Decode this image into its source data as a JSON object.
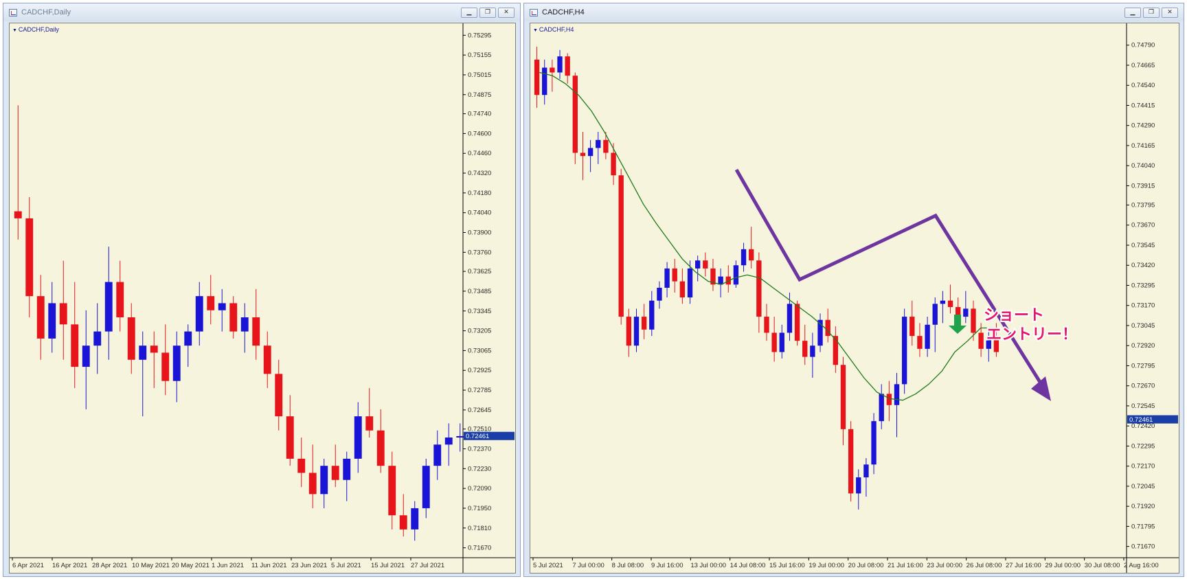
{
  "windows": [
    {
      "title": "CADCHF,Daily",
      "buttons": [
        "minimize",
        "restore",
        "close"
      ]
    },
    {
      "title": "CADCHF,H4",
      "buttons": [
        "minimize",
        "restore",
        "close"
      ]
    }
  ],
  "annotation": {
    "line1": "ショート",
    "line2": "エントリー！"
  },
  "colors": {
    "bull": "#1a14d6",
    "bear": "#e8141b",
    "ma": "#1f7a1a",
    "zigzag": "#6e35a0",
    "arrow": "#1fa34a",
    "background": "#f6f4dc"
  },
  "chart_data": [
    {
      "type": "candlestick",
      "title": "CADCHF,Daily",
      "ylim": [
        0.716,
        0.7535
      ],
      "yticks": [
        "0.75295",
        "0.75155",
        "0.75015",
        "0.74875",
        "0.74740",
        "0.74600",
        "0.74460",
        "0.74320",
        "0.74180",
        "0.74040",
        "0.73900",
        "0.73760",
        "0.73625",
        "0.73485",
        "0.73345",
        "0.73205",
        "0.73065",
        "0.72925",
        "0.72785",
        "0.72645",
        "0.72510",
        "0.72370",
        "0.72230",
        "0.72090",
        "0.71950",
        "0.71810",
        "0.71670"
      ],
      "current_price": "0.72461",
      "xticks": [
        "6 Apr 2021",
        "16 Apr 2021",
        "28 Apr 2021",
        "10 May 2021",
        "20 May 2021",
        "1 Jun 2021",
        "11 Jun 2021",
        "23 Jun 2021",
        "5 Jul 2021",
        "15 Jul 2021",
        "27 Jul 2021"
      ],
      "candles": [
        [
          0.7405,
          0.748,
          0.7385,
          0.74
        ],
        [
          0.74,
          0.7415,
          0.733,
          0.7345
        ],
        [
          0.7345,
          0.736,
          0.73,
          0.7315
        ],
        [
          0.7315,
          0.7355,
          0.7305,
          0.734
        ],
        [
          0.734,
          0.737,
          0.73,
          0.7325
        ],
        [
          0.7325,
          0.7355,
          0.728,
          0.7295
        ],
        [
          0.7295,
          0.7335,
          0.7265,
          0.731
        ],
        [
          0.731,
          0.734,
          0.729,
          0.732
        ],
        [
          0.732,
          0.738,
          0.73,
          0.7355
        ],
        [
          0.7355,
          0.737,
          0.732,
          0.733
        ],
        [
          0.733,
          0.734,
          0.729,
          0.73
        ],
        [
          0.73,
          0.732,
          0.726,
          0.731
        ],
        [
          0.731,
          0.732,
          0.728,
          0.7305
        ],
        [
          0.7305,
          0.7325,
          0.7275,
          0.7285
        ],
        [
          0.7285,
          0.732,
          0.727,
          0.731
        ],
        [
          0.731,
          0.7325,
          0.7295,
          0.732
        ],
        [
          0.732,
          0.7355,
          0.731,
          0.7345
        ],
        [
          0.7345,
          0.736,
          0.7325,
          0.7335
        ],
        [
          0.7335,
          0.735,
          0.732,
          0.734
        ],
        [
          0.734,
          0.7345,
          0.7315,
          0.732
        ],
        [
          0.732,
          0.734,
          0.7305,
          0.733
        ],
        [
          0.733,
          0.735,
          0.73,
          0.731
        ],
        [
          0.731,
          0.732,
          0.728,
          0.729
        ],
        [
          0.729,
          0.73,
          0.725,
          0.726
        ],
        [
          0.726,
          0.7275,
          0.7225,
          0.723
        ],
        [
          0.723,
          0.7245,
          0.721,
          0.722
        ],
        [
          0.722,
          0.724,
          0.7195,
          0.7205
        ],
        [
          0.7205,
          0.723,
          0.7195,
          0.7225
        ],
        [
          0.7225,
          0.724,
          0.721,
          0.7215
        ],
        [
          0.7215,
          0.7235,
          0.72,
          0.723
        ],
        [
          0.723,
          0.727,
          0.722,
          0.726
        ],
        [
          0.726,
          0.728,
          0.7245,
          0.725
        ],
        [
          0.725,
          0.7265,
          0.722,
          0.7225
        ],
        [
          0.7225,
          0.7235,
          0.718,
          0.719
        ],
        [
          0.719,
          0.7205,
          0.7175,
          0.718
        ],
        [
          0.718,
          0.72,
          0.7172,
          0.7195
        ],
        [
          0.7195,
          0.723,
          0.7188,
          0.7225
        ],
        [
          0.7225,
          0.725,
          0.7215,
          0.724
        ],
        [
          0.724,
          0.7255,
          0.7225,
          0.7245
        ],
        [
          0.7245,
          0.7255,
          0.7235,
          0.7246
        ]
      ]
    },
    {
      "type": "candlestick",
      "title": "CADCHF,H4",
      "ylim": [
        0.716,
        0.749
      ],
      "yticks": [
        "0.74790",
        "0.74665",
        "0.74540",
        "0.74415",
        "0.74290",
        "0.74165",
        "0.74040",
        "0.73915",
        "0.73795",
        "0.73670",
        "0.73545",
        "0.73420",
        "0.73295",
        "0.73170",
        "0.73045",
        "0.72920",
        "0.72795",
        "0.72670",
        "0.72545",
        "0.72420",
        "0.72295",
        "0.72170",
        "0.72045",
        "0.71920",
        "0.71795",
        "0.71670"
      ],
      "current_price": "0.72461",
      "xticks": [
        "5 Jul 2021",
        "7 Jul 00:00",
        "8 Jul 08:00",
        "9 Jul 16:00",
        "13 Jul 00:00",
        "14 Jul 08:00",
        "15 Jul 16:00",
        "19 Jul 00:00",
        "20 Jul 08:00",
        "21 Jul 16:00",
        "23 Jul 00:00",
        "26 Jul 08:00",
        "27 Jul 16:00",
        "29 Jul 00:00",
        "30 Jul 08:00",
        "2 Aug 16:00"
      ],
      "candles": [
        [
          0.747,
          0.7478,
          0.744,
          0.7448
        ],
        [
          0.7448,
          0.747,
          0.7442,
          0.7465
        ],
        [
          0.7465,
          0.747,
          0.745,
          0.7462
        ],
        [
          0.7462,
          0.7476,
          0.7458,
          0.7472
        ],
        [
          0.7472,
          0.7474,
          0.7455,
          0.746
        ],
        [
          0.746,
          0.7462,
          0.7405,
          0.7412
        ],
        [
          0.7412,
          0.7425,
          0.7395,
          0.741
        ],
        [
          0.741,
          0.742,
          0.74,
          0.7415
        ],
        [
          0.7415,
          0.7425,
          0.7405,
          0.742
        ],
        [
          0.742,
          0.7425,
          0.7408,
          0.7412
        ],
        [
          0.7412,
          0.7418,
          0.7392,
          0.7398
        ],
        [
          0.7398,
          0.7402,
          0.7305,
          0.731
        ],
        [
          0.731,
          0.7315,
          0.7285,
          0.7292
        ],
        [
          0.7292,
          0.7315,
          0.7288,
          0.731
        ],
        [
          0.731,
          0.7318,
          0.7296,
          0.7302
        ],
        [
          0.7302,
          0.7326,
          0.7298,
          0.732
        ],
        [
          0.732,
          0.7332,
          0.7315,
          0.7328
        ],
        [
          0.7328,
          0.7344,
          0.7322,
          0.734
        ],
        [
          0.734,
          0.7346,
          0.7325,
          0.7332
        ],
        [
          0.7332,
          0.734,
          0.7318,
          0.7322
        ],
        [
          0.7322,
          0.7345,
          0.7318,
          0.734
        ],
        [
          0.734,
          0.7348,
          0.7332,
          0.7345
        ],
        [
          0.7345,
          0.735,
          0.7335,
          0.734
        ],
        [
          0.734,
          0.7346,
          0.7326,
          0.733
        ],
        [
          0.733,
          0.734,
          0.7322,
          0.7335
        ],
        [
          0.7335,
          0.7342,
          0.7325,
          0.733
        ],
        [
          0.733,
          0.7345,
          0.7328,
          0.7342
        ],
        [
          0.7342,
          0.7356,
          0.7338,
          0.7352
        ],
        [
          0.7352,
          0.7366,
          0.734,
          0.7345
        ],
        [
          0.7345,
          0.735,
          0.73,
          0.731
        ],
        [
          0.731,
          0.7318,
          0.7295,
          0.73
        ],
        [
          0.73,
          0.731,
          0.7282,
          0.7288
        ],
        [
          0.7288,
          0.7305,
          0.7284,
          0.73
        ],
        [
          0.73,
          0.7325,
          0.7295,
          0.7318
        ],
        [
          0.7318,
          0.732,
          0.7292,
          0.7295
        ],
        [
          0.7295,
          0.7305,
          0.728,
          0.7285
        ],
        [
          0.7285,
          0.73,
          0.7272,
          0.7292
        ],
        [
          0.7292,
          0.7312,
          0.7288,
          0.7308
        ],
        [
          0.7308,
          0.7315,
          0.7294,
          0.7298
        ],
        [
          0.7298,
          0.7304,
          0.7275,
          0.728
        ],
        [
          0.728,
          0.7285,
          0.723,
          0.724
        ],
        [
          0.724,
          0.7245,
          0.7195,
          0.72
        ],
        [
          0.72,
          0.7215,
          0.719,
          0.721
        ],
        [
          0.721,
          0.7222,
          0.7198,
          0.7218
        ],
        [
          0.7218,
          0.725,
          0.7212,
          0.7245
        ],
        [
          0.7245,
          0.7268,
          0.724,
          0.7262
        ],
        [
          0.7262,
          0.727,
          0.7245,
          0.7255
        ],
        [
          0.7255,
          0.7275,
          0.7235,
          0.7268
        ],
        [
          0.7268,
          0.7315,
          0.7262,
          0.731
        ],
        [
          0.731,
          0.732,
          0.7292,
          0.7298
        ],
        [
          0.7298,
          0.7306,
          0.7285,
          0.729
        ],
        [
          0.729,
          0.731,
          0.7285,
          0.7305
        ],
        [
          0.7305,
          0.7322,
          0.7288,
          0.7318
        ],
        [
          0.7318,
          0.7326,
          0.7306,
          0.732
        ],
        [
          0.732,
          0.733,
          0.7312,
          0.7316
        ],
        [
          0.7316,
          0.7322,
          0.7305,
          0.731
        ],
        [
          0.731,
          0.7326,
          0.7306,
          0.7315
        ],
        [
          0.7315,
          0.732,
          0.7295,
          0.73
        ],
        [
          0.73,
          0.7306,
          0.7285,
          0.729
        ],
        [
          0.729,
          0.7302,
          0.7282,
          0.7298
        ],
        [
          0.7298,
          0.7306,
          0.7285,
          0.7288
        ]
      ],
      "moving_average": [
        0.7462,
        0.746,
        0.7455,
        0.7448,
        0.7438,
        0.7425,
        0.741,
        0.7395,
        0.738,
        0.7368,
        0.7357,
        0.7346,
        0.7338,
        0.7332,
        0.733,
        0.7334,
        0.7336,
        0.7334,
        0.7328,
        0.7322,
        0.7316,
        0.731,
        0.7303,
        0.7294,
        0.7283,
        0.7272,
        0.7263,
        0.7259,
        0.7258,
        0.7262,
        0.7268,
        0.7276,
        0.7288,
        0.7295,
        0.7303,
        0.7303
      ],
      "annotation_text": "ショート エントリー！"
    }
  ]
}
